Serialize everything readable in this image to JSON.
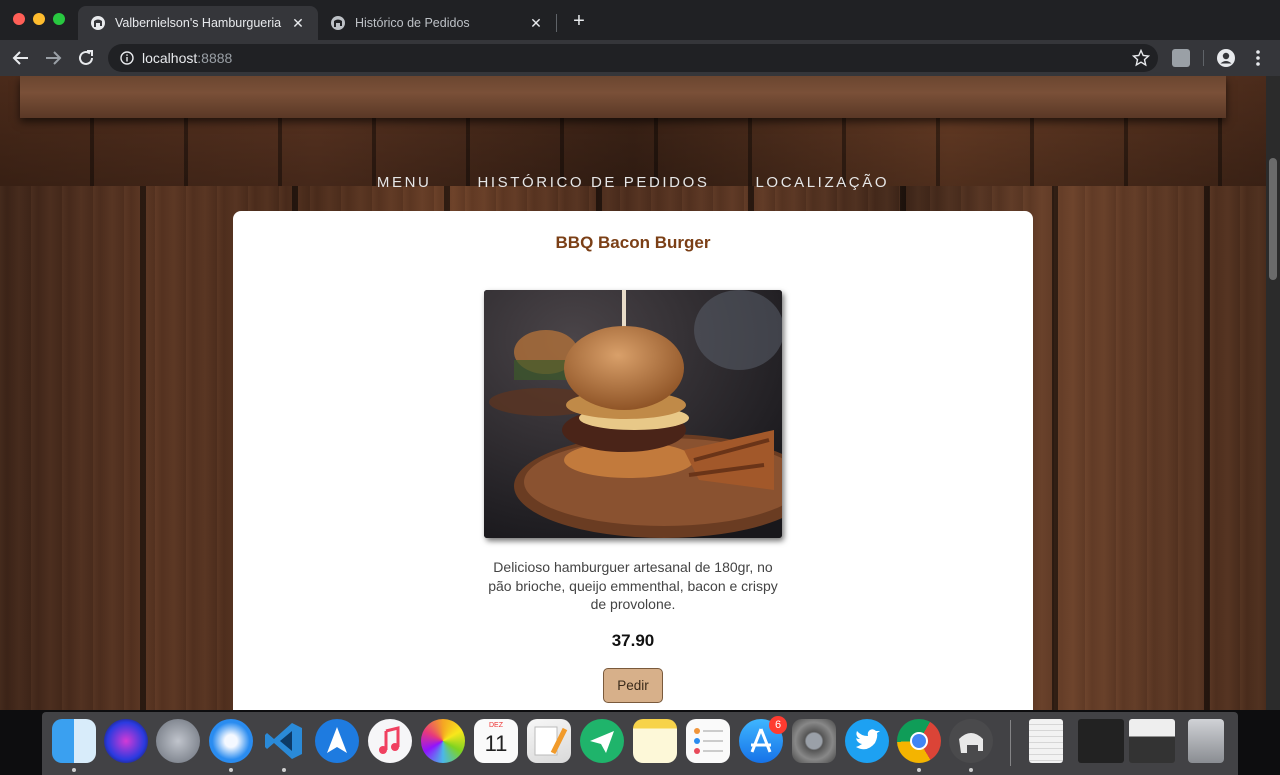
{
  "browser": {
    "tabs": [
      {
        "title": "Valbernielson's Hamburgueria",
        "active": true
      },
      {
        "title": "Histórico de Pedidos",
        "active": false
      }
    ],
    "url_host": "localhost",
    "url_port": ":8888"
  },
  "site": {
    "nav": [
      "MENU",
      "HISTÓRICO DE PEDIDOS",
      "LOCALIZAÇÃO"
    ],
    "product": {
      "name": "BBQ Bacon Burger",
      "description": "Delicioso hamburguer artesanal de 180gr, no pão brioche, queijo emmenthal, bacon e crispy de provolone.",
      "price": "37.90",
      "order_label": "Pedir"
    }
  },
  "dock": {
    "calendar_month": "DEZ",
    "calendar_day": "11",
    "appstore_badge": "6",
    "apps": [
      "finder-icon",
      "siri-icon",
      "launchpad-icon",
      "safari-icon",
      "vscode-icon",
      "spark-icon",
      "music-icon",
      "photos-icon",
      "calendar-icon",
      "pages-icon",
      "airmail-icon",
      "notes-icon",
      "reminders-icon",
      "appstore-icon",
      "system-preferences-icon",
      "twitter-icon",
      "chrome-icon",
      "tableplus-icon"
    ]
  },
  "colors": {
    "accent": "#7b3f16",
    "button": "#d7b08a"
  }
}
